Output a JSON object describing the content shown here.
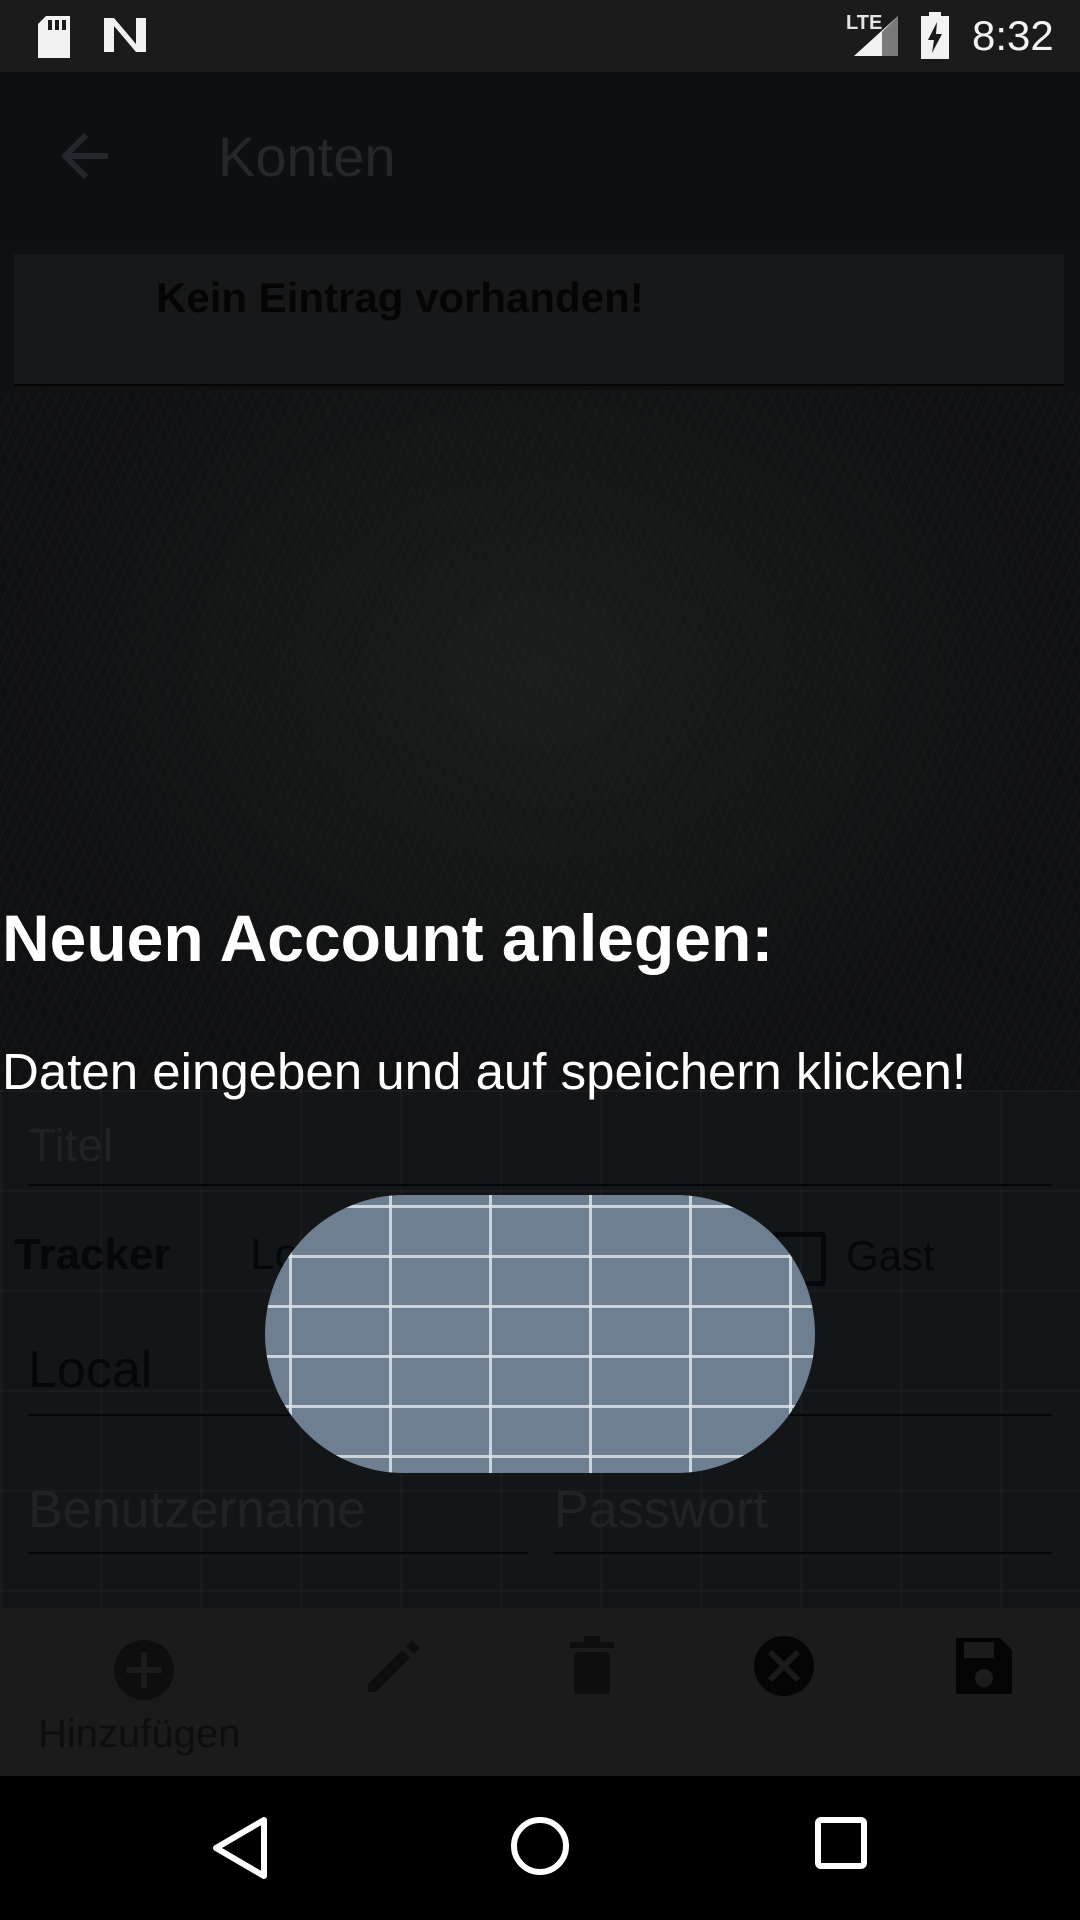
{
  "status_bar": {
    "network": "LTE",
    "time": "8:32",
    "icons": [
      "sd-card-icon",
      "n-logo-icon",
      "signal-icon",
      "battery-charging-icon"
    ]
  },
  "app_bar": {
    "back_icon": "arrow-back-icon",
    "title": "Konten"
  },
  "list": {
    "empty_message": "Kein Eintrag vorhanden!"
  },
  "form": {
    "title_placeholder": "Titel",
    "tracker_label": "Tracker",
    "tracker_value": "Local",
    "guest_label": "Gast",
    "guest_checked": false,
    "url_value": "Local",
    "username_placeholder": "Benutzername",
    "password_placeholder": "Passwort"
  },
  "toolbar": {
    "add_label": "Hinzufügen",
    "icons": [
      "add-circle-icon",
      "edit-icon",
      "delete-icon",
      "cancel-icon",
      "save-icon"
    ]
  },
  "dialog": {
    "title": "Neuen Account anlegen:",
    "message": "Daten eingeben und auf speichern klicken!"
  },
  "nav_bar": {
    "icons": [
      "back-triangle-icon",
      "home-circle-icon",
      "recents-square-icon"
    ]
  },
  "colors": {
    "pill_fill": "#6e7f92",
    "pill_grid": "#dce2e8",
    "overlay_text": "#ffffff"
  }
}
